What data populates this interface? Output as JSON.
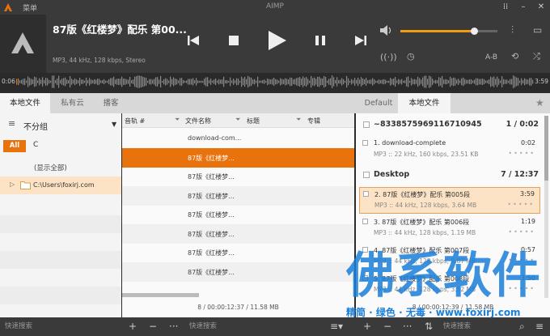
{
  "window": {
    "menu_label": "菜单",
    "title": "AIMP",
    "controls": [
      "grid-icon",
      "minimize-icon",
      "close-icon"
    ]
  },
  "player": {
    "title": "87版《红楼梦》配乐 第00...",
    "info": "MP3, 44 kHz, 128 kbps, Stereo",
    "volume_fraction": 0.76,
    "repeat_mode": "A-B",
    "time_elapsed": "0:06",
    "time_total": "3:59"
  },
  "tabs_left": [
    {
      "label": "本地文件",
      "active": true
    },
    {
      "label": "私有云",
      "active": false
    },
    {
      "label": "播客",
      "active": false
    }
  ],
  "tabs_right": [
    {
      "label": "Default",
      "active": false
    },
    {
      "label": "本地文件",
      "active": true
    }
  ],
  "library": {
    "group_label": "不分组",
    "filter_all": "All",
    "filter_letter": "C",
    "show_all": "(显示全部)",
    "folder": "C:\\Users\\foxirj.com"
  },
  "table": {
    "headers": [
      "音轨 #",
      "文件名称",
      "标题",
      "专辑"
    ],
    "rows": [
      {
        "track": "",
        "file": "download-com...",
        "title": "",
        "album": "",
        "selected": false
      },
      {
        "track": "",
        "file": "87版《红楼梦...",
        "title": "",
        "album": "",
        "selected": true
      },
      {
        "track": "",
        "file": "87版《红楼梦...",
        "title": "",
        "album": "",
        "selected": false
      },
      {
        "track": "",
        "file": "87版《红楼梦...",
        "title": "",
        "album": "",
        "selected": false
      },
      {
        "track": "",
        "file": "87版《红楼梦...",
        "title": "",
        "album": "",
        "selected": false
      },
      {
        "track": "",
        "file": "87版《红楼梦...",
        "title": "",
        "album": "",
        "selected": false
      },
      {
        "track": "",
        "file": "87版《红楼梦...",
        "title": "",
        "album": "",
        "selected": false
      },
      {
        "track": "",
        "file": "87版《红楼梦...",
        "title": "",
        "album": "",
        "selected": false
      }
    ],
    "summary": "8 / 00:00:12:37 / 11.58 MB"
  },
  "playlist": {
    "groups": [
      {
        "name": "~8338575969116710945",
        "count": "1 / 0:02",
        "items": [
          {
            "name": "1. download-complete",
            "duration": "0:02",
            "info": "MP3 :: 22 kHz, 160 kbps, 23.51 KB",
            "playing": false
          }
        ]
      },
      {
        "name": "Desktop",
        "count": "7 / 12:37",
        "items": [
          {
            "name": "2. 87版《红楼梦》配乐 第005段",
            "duration": "3:59",
            "info": "MP3 :: 44 kHz, 128 kbps, 3.64 MB",
            "playing": true
          },
          {
            "name": "3. 87版《红楼梦》配乐 第006段",
            "duration": "1:19",
            "info": "MP3 :: 44 kHz, 128 kbps, 1.19 MB",
            "playing": false
          },
          {
            "name": "4. 87版《红楼梦》配乐 第007段",
            "duration": "0:57",
            "info": "MP3 :: 44 kHz, 128 kbps, 0.87 MB",
            "playing": false
          },
          {
            "name": "5. 87版《红楼梦》配乐 第008段",
            "duration": "3:50",
            "info": "MP3 :: 44 kHz, 128 kbps, 3.52 MB",
            "playing": false
          }
        ]
      }
    ],
    "summary": "8 / 00:00:12:39 / 11.58 MB"
  },
  "bottom": {
    "search_placeholder_left": "快速搜索",
    "search_placeholder_mid": "快速搜索",
    "search_placeholder_right": "快速搜索"
  },
  "watermark": {
    "main": "佛系软件",
    "sub": "精简 · 绿色 · 无毒 · www.foxirj.com"
  },
  "colors": {
    "accent": "#e8720c",
    "dark_bg": "#3a3a3a",
    "watermark": "#1a7fd8"
  }
}
